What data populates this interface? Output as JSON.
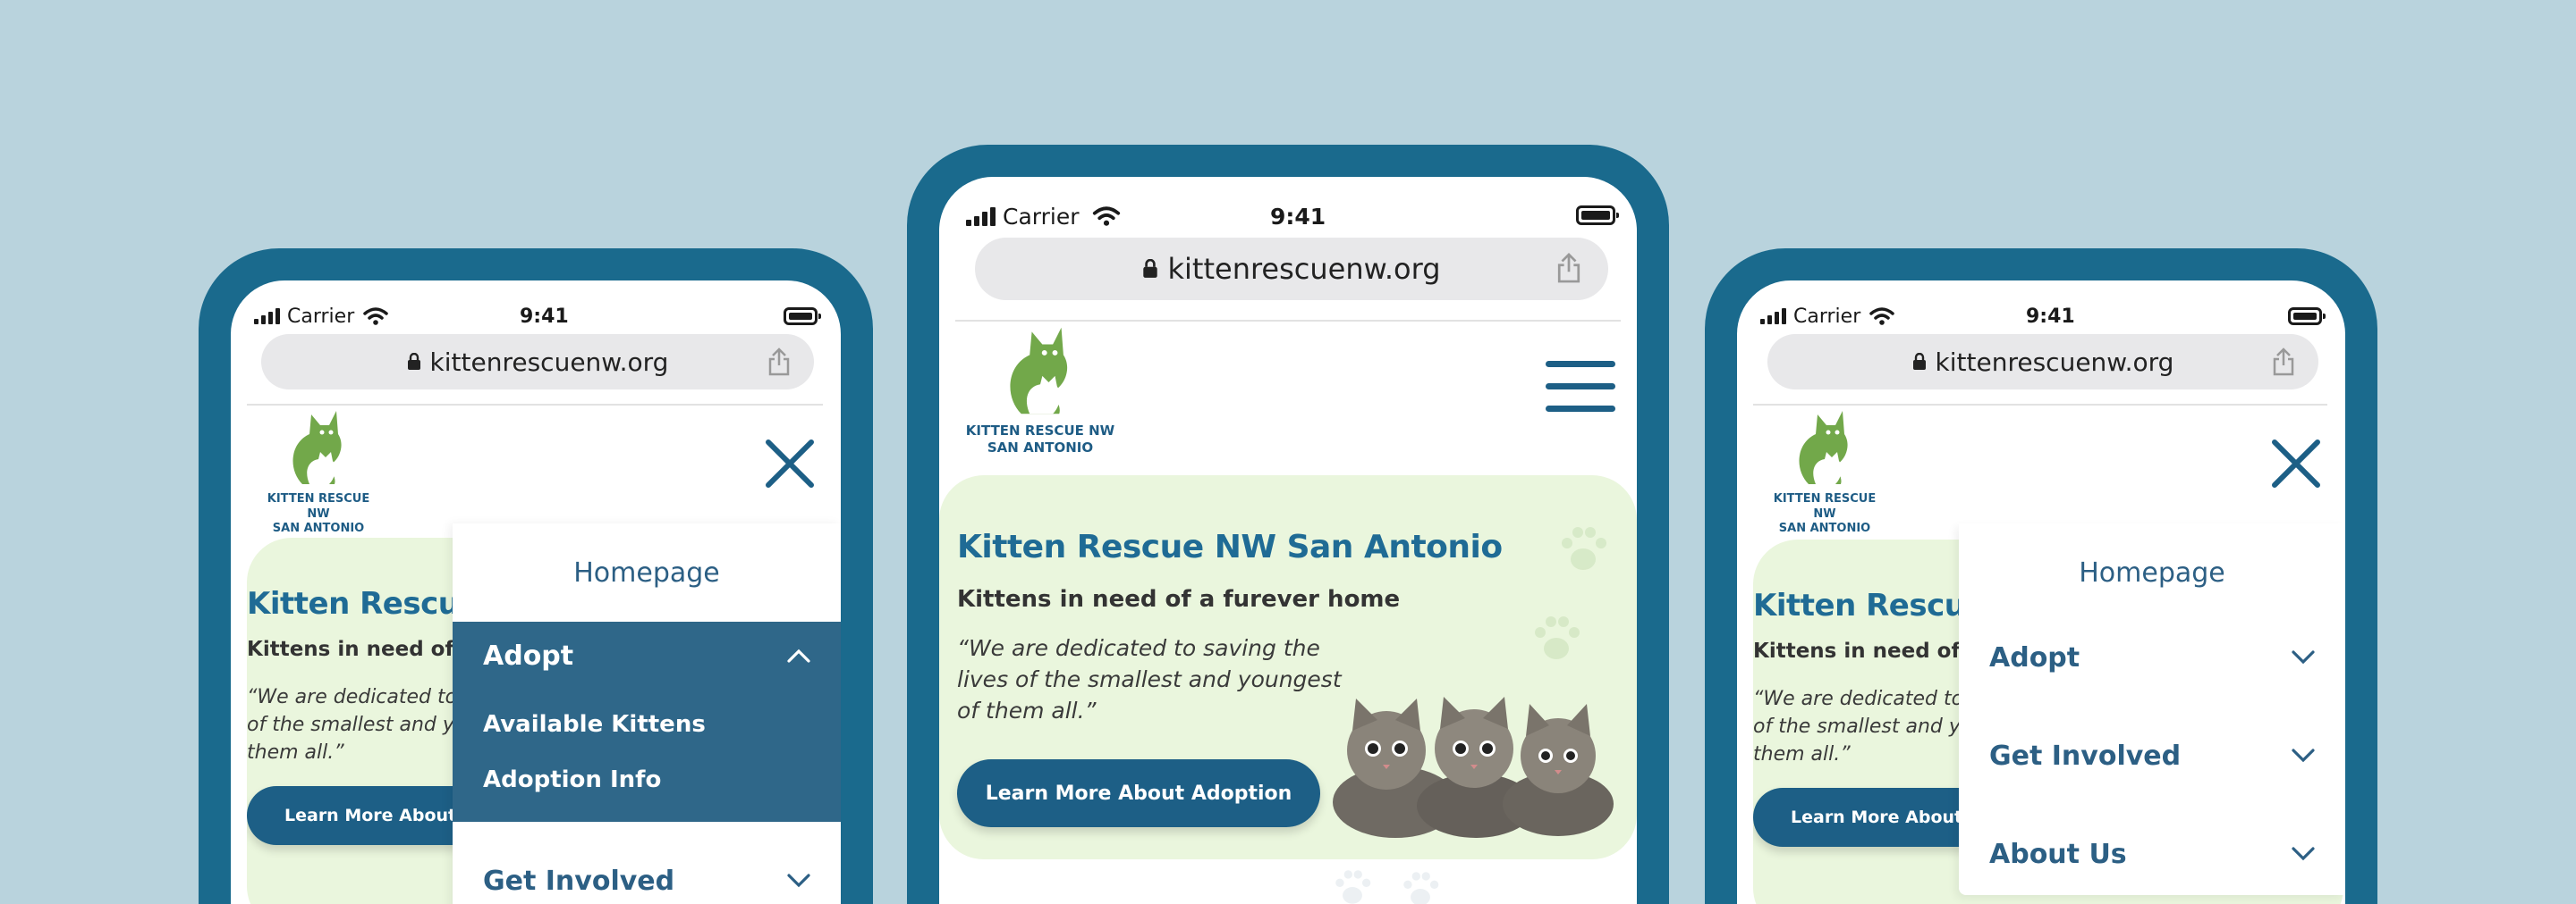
{
  "status": {
    "carrier": "Carrier",
    "time": "9:41"
  },
  "browser": {
    "url": "kittenrescuenw.org"
  },
  "logo": {
    "line1": "KITTEN RESCUE NW",
    "line2": "SAN ANTONIO"
  },
  "hero": {
    "title": "Kitten Rescue NW San Antonio",
    "subtitle": "Kittens in need of a furever home",
    "quote": "“We are dedicated to saving the lives of the smallest and youngest of them all.”",
    "cta": "Learn More About Adoption"
  },
  "left": {
    "hero_title": "Kitten Rescue N",
    "hero_subtitle": "Kittens in need of a",
    "quote_l1": "“We are dedicated to sa",
    "quote_l2": "of the smallest and you",
    "quote_l3": "them all.”",
    "cta": "Learn More About A"
  },
  "menu": {
    "homepage": "Homepage",
    "adopt": "Adopt",
    "available_kittens": "Available Kittens",
    "adoption_info": "Adoption Info",
    "get_involved": "Get Involved",
    "about_us": "About Us"
  },
  "colors": {
    "background": "#b9d3dd",
    "phone_frame": "#1a6a8d",
    "brand": "#1d5f86",
    "hero_bg": "#eaf6dd",
    "logo_green": "#72a84a"
  },
  "icons": [
    "signal-icon",
    "wifi-icon",
    "battery-icon",
    "lock-icon",
    "share-icon",
    "close-icon",
    "hamburger-icon",
    "chevron-up-icon",
    "chevron-down-icon",
    "cat-logo-icon",
    "paw-icon"
  ]
}
